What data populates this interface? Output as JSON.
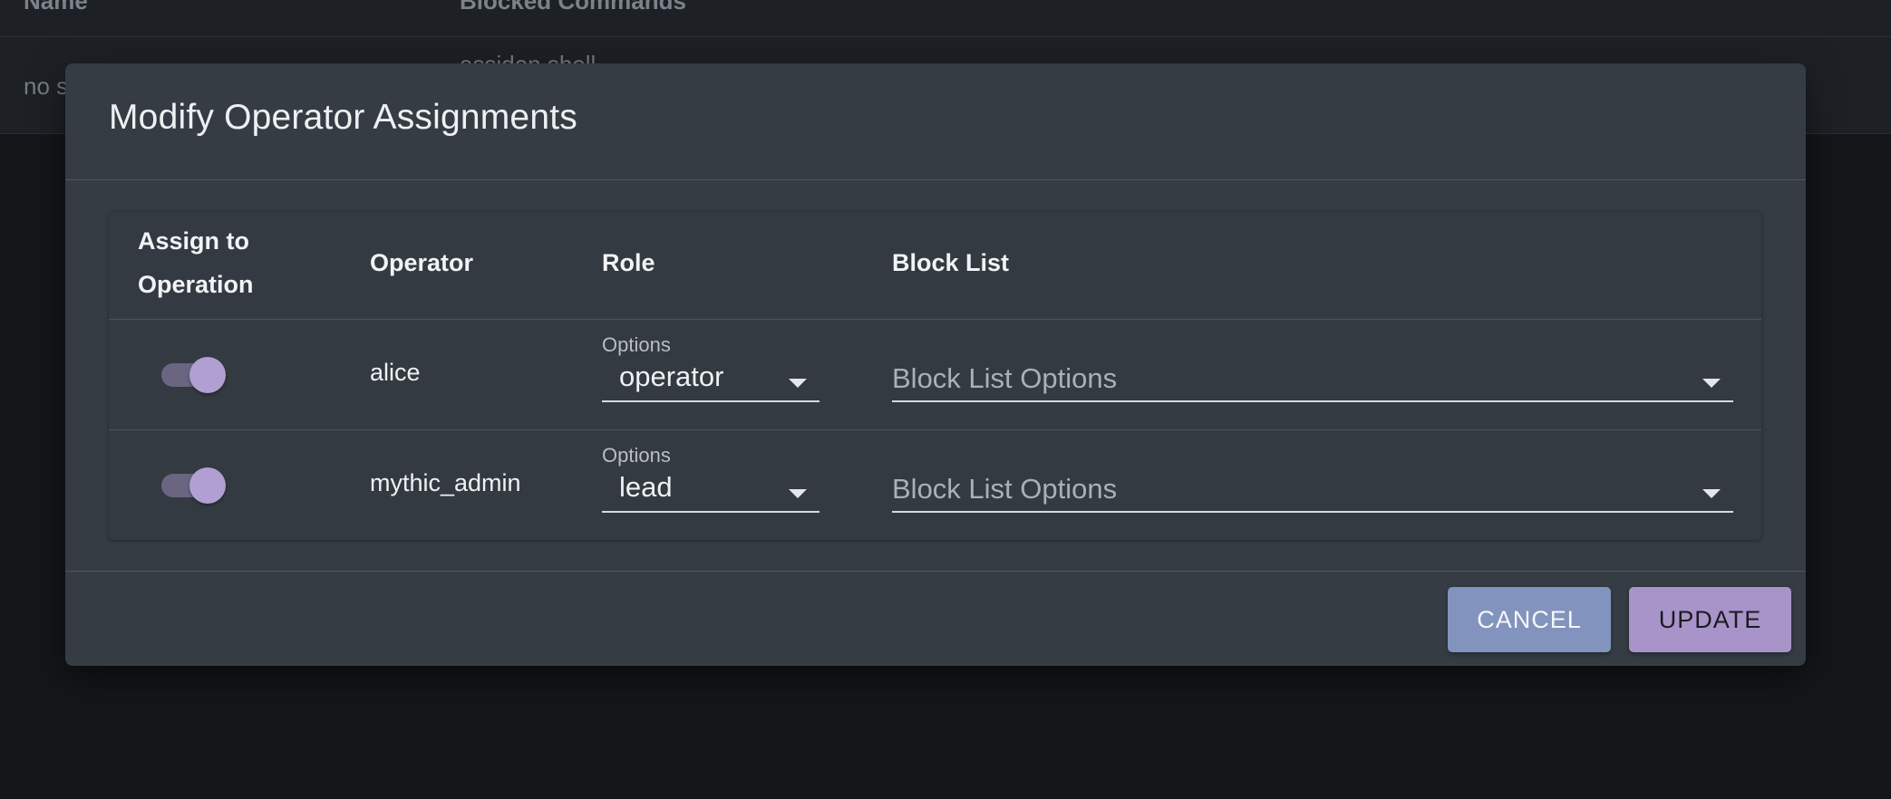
{
  "background_table": {
    "headers": {
      "name": "Name",
      "blocked_commands": "Blocked Commands"
    },
    "row": {
      "name": "no s",
      "blocked_commands": "assidon shell"
    }
  },
  "modal": {
    "title": "Modify Operator Assignments",
    "columns": {
      "assign": "Assign to Operation",
      "operator": "Operator",
      "role": "Role",
      "block_list": "Block List"
    },
    "rows": [
      {
        "assigned": true,
        "operator": "alice",
        "role_label": "Options",
        "role": "operator",
        "block_list_placeholder": "Block List Options"
      },
      {
        "assigned": true,
        "operator": "mythic_admin",
        "role_label": "Options",
        "role": "lead",
        "block_list_placeholder": "Block List Options"
      }
    ],
    "buttons": {
      "cancel": "CANCEL",
      "update": "UPDATE"
    }
  },
  "colors": {
    "modal_background": "#353c44",
    "toggle_on": "#b19fd4",
    "cancel_button": "#8293bd",
    "update_button": "#a894c8"
  },
  "icons": {
    "dropdown": "chevron-down-icon"
  }
}
